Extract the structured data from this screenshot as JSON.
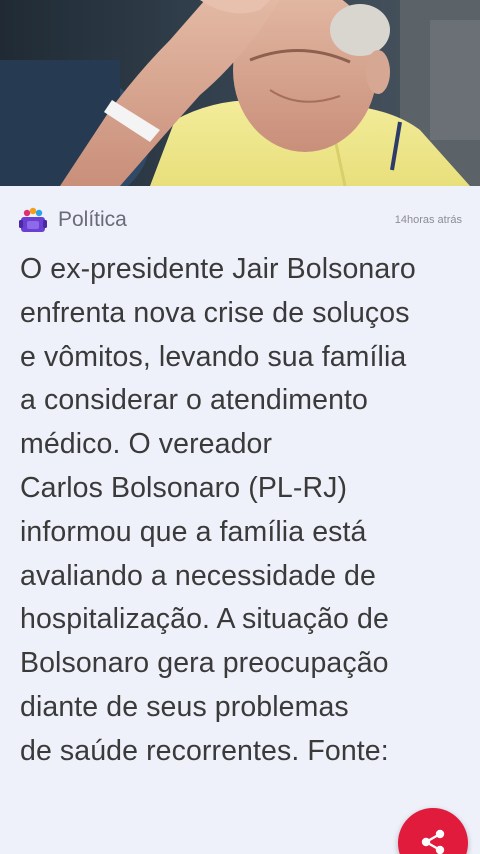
{
  "article": {
    "category": "Política",
    "timestamp": "14horas atrás",
    "body_lines": [
      "O ex-presidente Jair Bolsonaro",
      "enfrenta nova crise de soluços",
      "e vômitos, levando sua família",
      "a considerar o atendimento",
      "médico. O vereador",
      "Carlos Bolsonaro (PL-RJ)",
      "informou que a família está",
      "avaliando a necessidade de",
      "hospitalização. A situação de",
      "Bolsonaro gera preocupação",
      "diante de seus problemas",
      "de saúde recorrentes. Fonte:"
    ]
  },
  "icons": {
    "category_icon": "category-icon",
    "share_icon": "share-icon"
  },
  "colors": {
    "background": "#eef0fa",
    "category_text": "#6b6b78",
    "body_text": "#3a3a3a",
    "share_button": "#e01b3c",
    "category_icon_primary": "#6a3fd1"
  }
}
